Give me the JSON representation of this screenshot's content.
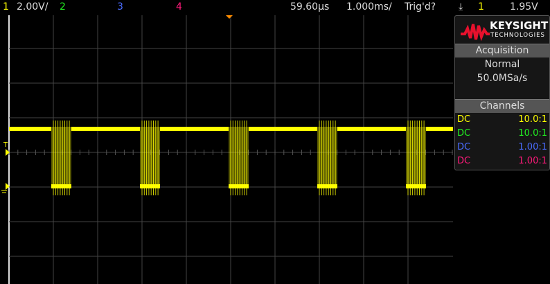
{
  "topbar": {
    "ch1": "1",
    "ch1_scale": "2.00V/",
    "ch2": "2",
    "ch3": "3",
    "ch4": "4",
    "delay": "59.60µs",
    "timebase": "1.000ms/",
    "trigger_status": "Trig'd?",
    "trigger_slope_icon": "falling-edge-icon",
    "trigger_source": "1",
    "trigger_level": "1.95V"
  },
  "panel": {
    "brand": "KEYSIGHT",
    "brand_sub": "TECHNOLOGIES",
    "acq_title": "Acquisition",
    "acq_mode": "Normal",
    "sample_rate": "50.0MSa/s",
    "channels_title": "Channels",
    "channels": [
      {
        "coupling": "DC",
        "probe": "10.0:1",
        "color": "#ffff00"
      },
      {
        "coupling": "DC",
        "probe": "10.0:1",
        "color": "#22ee22"
      },
      {
        "coupling": "DC",
        "probe": "1.00:1",
        "color": "#4a6cff"
      },
      {
        "coupling": "DC",
        "probe": "1.00:1",
        "color": "#ff1a7a"
      }
    ]
  },
  "markers": {
    "trigger_label": "T",
    "ground_label": "1"
  },
  "colors": {
    "ch1": "#ffff00",
    "ch2": "#22ee22",
    "ch3": "#4a6cff",
    "ch4": "#ff1a7a",
    "trigger": "#ff8c00"
  }
}
